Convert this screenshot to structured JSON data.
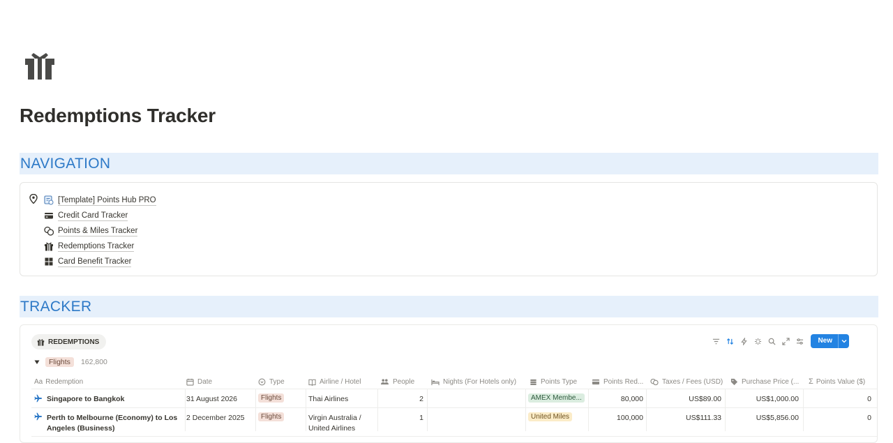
{
  "page": {
    "icon": "gift-icon",
    "title": "Redemptions Tracker"
  },
  "sections": {
    "navigation": "NAVIGATION",
    "tracker": "TRACKER"
  },
  "nav": {
    "pin_icon": "map-pin-icon",
    "items": [
      {
        "label": "[Template] Points Hub PRO",
        "icon": "hub-icon"
      },
      {
        "label": "Credit Card Tracker",
        "icon": "credit-card-icon"
      },
      {
        "label": "Points & Miles Tracker",
        "icon": "coins-icon"
      },
      {
        "label": "Redemptions Tracker",
        "icon": "gift-icon"
      },
      {
        "label": "Card Benefit Tracker",
        "icon": "grid-icon"
      }
    ]
  },
  "database": {
    "view_label": "REDEMPTIONS",
    "new_label": "New",
    "group": {
      "label": "Flights",
      "count": "162,800"
    },
    "columns": [
      {
        "label": "Redemption",
        "icon": "text-icon"
      },
      {
        "label": "Date",
        "icon": "calendar-icon"
      },
      {
        "label": "Type",
        "icon": "select-icon"
      },
      {
        "label": "Airline / Hotel",
        "icon": "book-icon"
      },
      {
        "label": "People",
        "icon": "people-icon"
      },
      {
        "label": "Nights (For Hotels only)",
        "icon": "bed-icon"
      },
      {
        "label": "Points Type",
        "icon": "stack-icon"
      },
      {
        "label": "Points Red...",
        "icon": "card-icon"
      },
      {
        "label": "Taxes / Fees (USD)",
        "icon": "coins-icon"
      },
      {
        "label": "Purchase Price (...",
        "icon": "tag-icon"
      },
      {
        "label": "Points Value ($)",
        "icon": "sigma-icon"
      }
    ],
    "rows": [
      {
        "redemption": "Singapore to Bangkok",
        "date": "31 August 2026",
        "type": "Flights",
        "airline": "Thai Airlines",
        "people": "2",
        "nights": "",
        "points_type": "AMEX Membe...",
        "points_redeemed": "80,000",
        "taxes": "US$89.00",
        "purchase_price": "US$1,000.00",
        "points_value": "0"
      },
      {
        "redemption": "Perth to Melbourne (Economy) to Los Angeles (Business)",
        "date": "2 December 2025",
        "type": "Flights",
        "airline": "Virgin Australia / United Airlines",
        "people": "1",
        "nights": "",
        "points_type": "United Miles",
        "points_redeemed": "100,000",
        "taxes": "US$111.33",
        "purchase_price": "US$5,856.00",
        "points_value": "0"
      }
    ]
  },
  "colors": {
    "accent": "#2383e2",
    "section_text": "#2d79c7",
    "section_bg": "#e6f0fb"
  }
}
